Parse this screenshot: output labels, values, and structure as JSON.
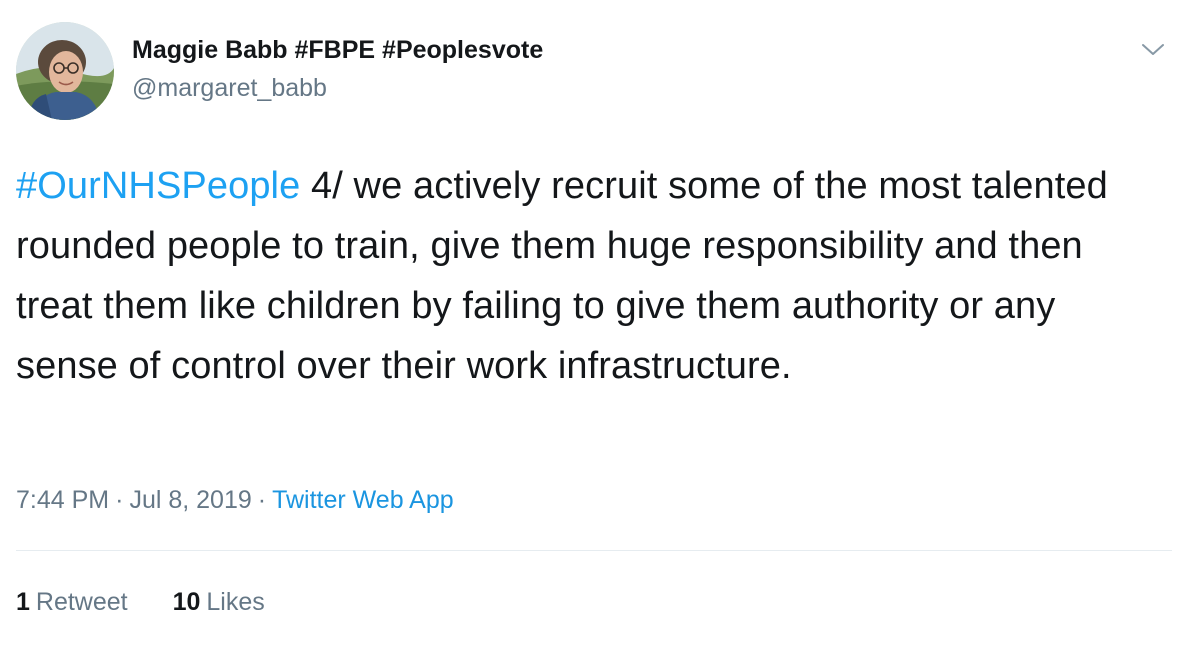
{
  "user": {
    "display_name": "Maggie Babb #FBPE #Peoplesvote",
    "handle": "@margaret_babb",
    "avatar_icon": "profile-photo"
  },
  "tweet": {
    "hashtag": "#OurNHSPeople",
    "text": " 4/ we actively recruit some of the most talented rounded people to train, give them huge responsibility and then treat them like children by failing to give them authority or any sense of control over their work infrastructure."
  },
  "meta": {
    "time": "7:44 PM",
    "separator": "·",
    "date": "Jul 8, 2019",
    "app": "Twitter Web App"
  },
  "stats": {
    "retweets_count": "1",
    "retweets_label": "Retweet",
    "likes_count": "10",
    "likes_label": "Likes"
  },
  "colors": {
    "link": "#1da1f2",
    "muted": "#657786",
    "text": "#14171a",
    "divider": "#e6ecf0"
  },
  "icons": {
    "menu": "chevron-down-icon"
  }
}
